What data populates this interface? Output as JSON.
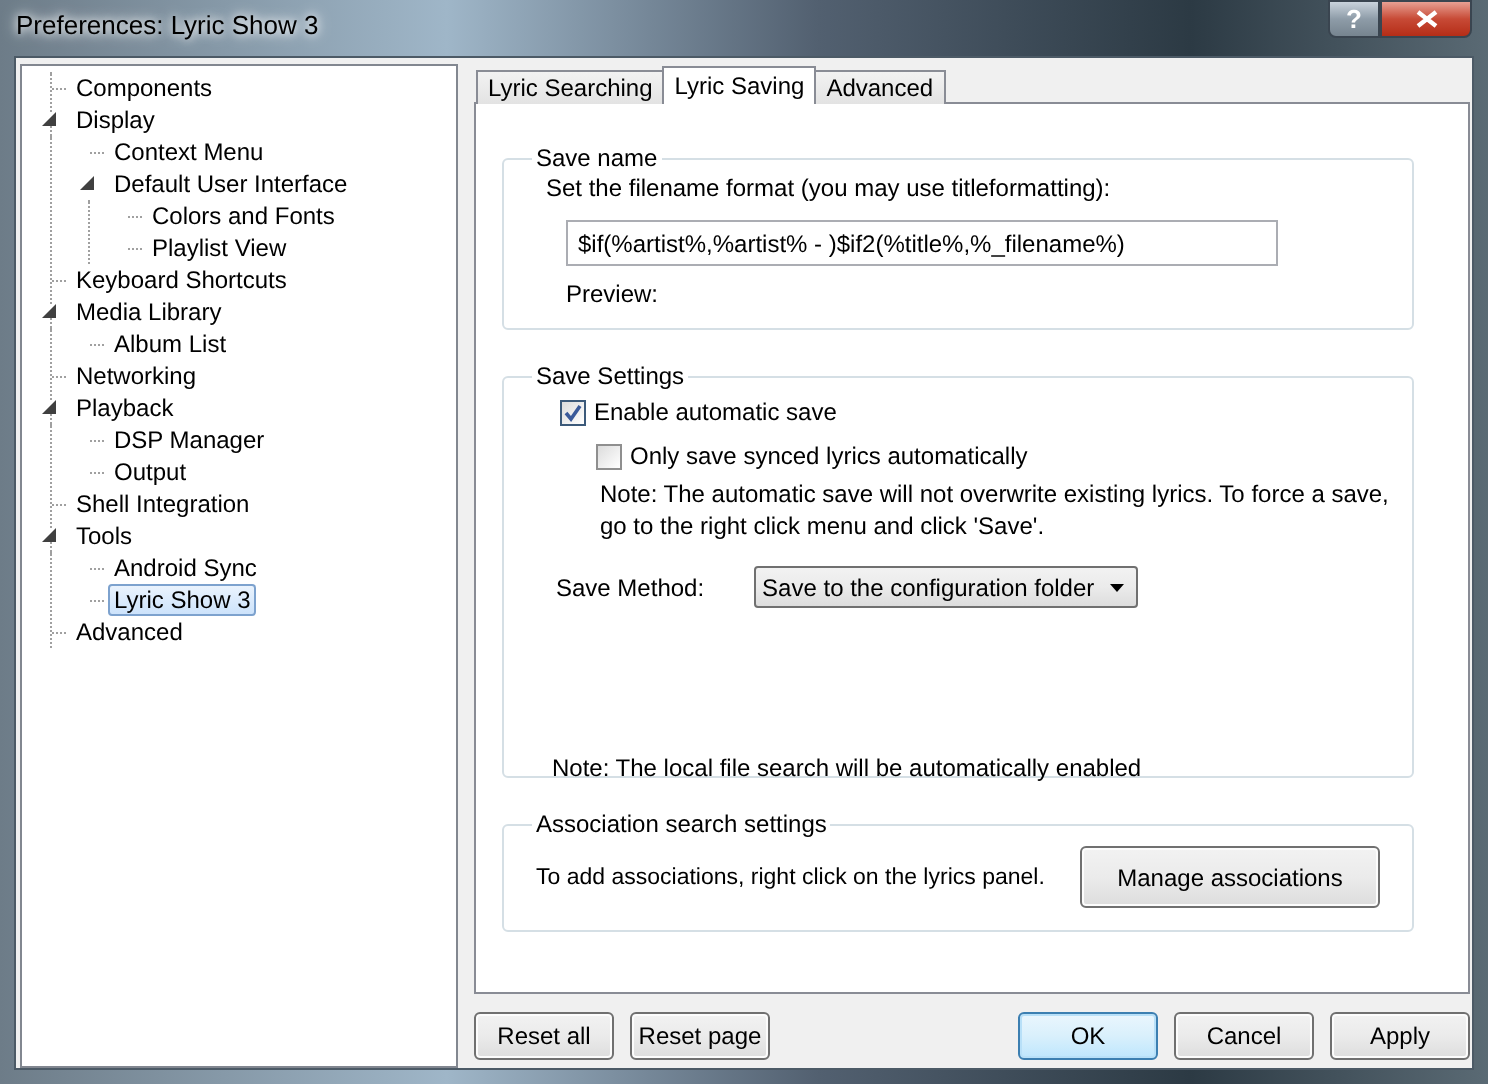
{
  "window": {
    "title": "Preferences: Lyric Show 3",
    "help_button": "?"
  },
  "tree": [
    {
      "label": "Components",
      "selected": false
    },
    {
      "label": "Display",
      "selected": false,
      "expanded": true,
      "children": [
        {
          "label": "Context Menu",
          "selected": false
        },
        {
          "label": "Default User Interface",
          "selected": false,
          "expanded": true,
          "children": [
            {
              "label": "Colors and Fonts",
              "selected": false
            },
            {
              "label": "Playlist View",
              "selected": false
            }
          ]
        }
      ]
    },
    {
      "label": "Keyboard Shortcuts",
      "selected": false
    },
    {
      "label": "Media Library",
      "selected": false,
      "expanded": true,
      "children": [
        {
          "label": "Album List",
          "selected": false
        }
      ]
    },
    {
      "label": "Networking",
      "selected": false
    },
    {
      "label": "Playback",
      "selected": false,
      "expanded": true,
      "children": [
        {
          "label": "DSP Manager",
          "selected": false
        },
        {
          "label": "Output",
          "selected": false
        }
      ]
    },
    {
      "label": "Shell Integration",
      "selected": false
    },
    {
      "label": "Tools",
      "selected": false,
      "expanded": true,
      "children": [
        {
          "label": "Android Sync",
          "selected": false
        },
        {
          "label": "Lyric Show 3",
          "selected": true
        }
      ]
    },
    {
      "label": "Advanced",
      "selected": false
    }
  ],
  "tabs": [
    {
      "label": "Lyric Searching",
      "selected": false
    },
    {
      "label": "Lyric Saving",
      "selected": true
    },
    {
      "label": "Advanced",
      "selected": false
    }
  ],
  "save_name": {
    "title": "Save name",
    "label": "Set the filename format (you may use titleformatting):",
    "value": "$if(%artist%,%artist% - )$if2(%title%,%_filename%)",
    "preview_label": "Preview:"
  },
  "save_settings": {
    "title": "Save Settings",
    "options": [
      {
        "label": "Enable automatic save",
        "checked": true,
        "children": [
          {
            "label": "Only save synced lyrics automatically",
            "checked": false
          }
        ]
      }
    ],
    "note": "Note: The automatic save will not overwrite existing lyrics. To force a save, go to the right click menu and click 'Save'.",
    "method_label": "Save Method:",
    "method_value": "Save to the configuration folder",
    "footnote": "Note: The local file search will be automatically enabled"
  },
  "association": {
    "title": "Association search settings",
    "text": "To add associations, right click on the lyrics panel.",
    "button": "Manage associations"
  },
  "left_buttons": [
    {
      "label": "Reset all",
      "default": false
    },
    {
      "label": "Reset page",
      "default": false
    }
  ],
  "right_buttons": [
    {
      "label": "OK",
      "default": true
    },
    {
      "label": "Cancel",
      "default": false
    },
    {
      "label": "Apply",
      "default": false
    }
  ]
}
